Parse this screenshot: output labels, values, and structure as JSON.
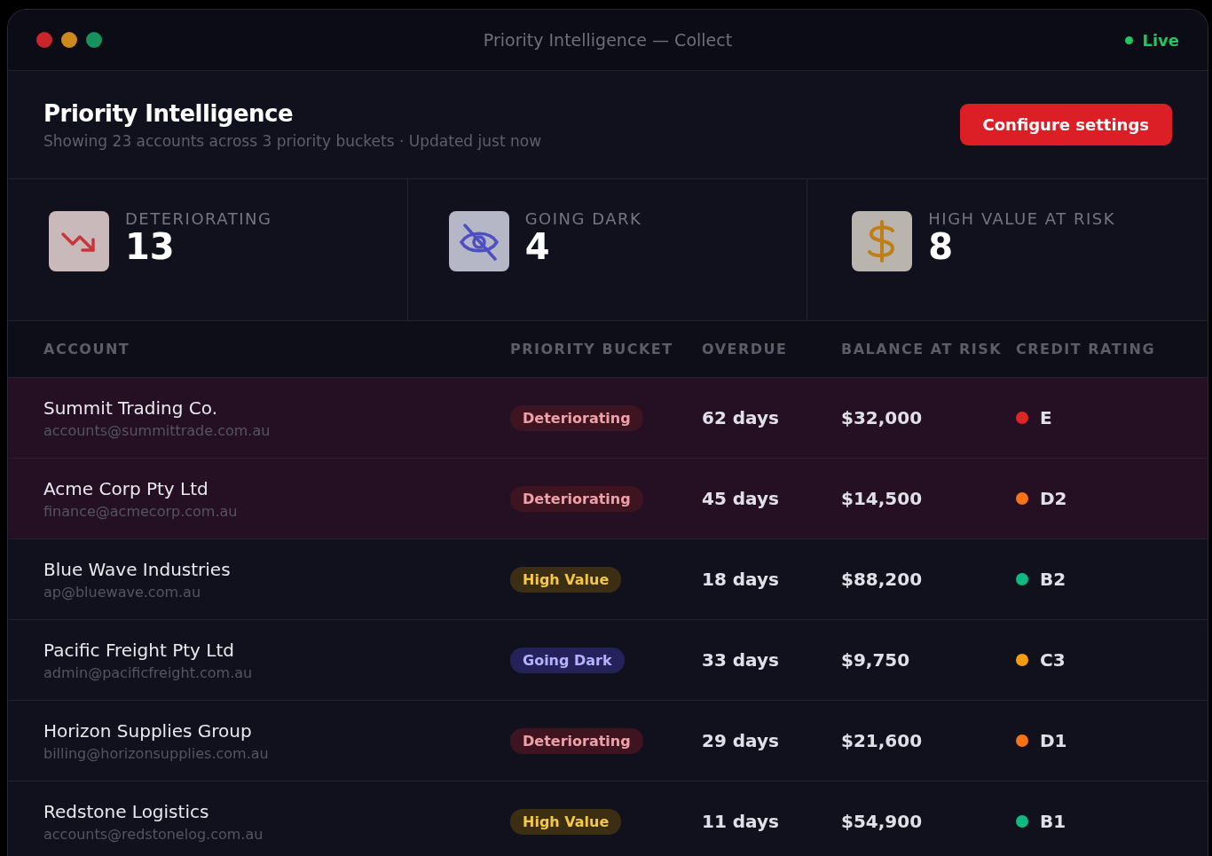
{
  "window": {
    "title": "Priority Intelligence — Collect",
    "status": {
      "label": "Live",
      "color": "#22c55e"
    }
  },
  "header": {
    "title": "Priority Intelligence",
    "subtitle": "Showing 23 accounts across 3 priority buckets · Updated just now",
    "button": "Configure settings"
  },
  "stats": [
    {
      "kind": "deteriorating",
      "label": "DETERIORATING",
      "value": "13"
    },
    {
      "kind": "going_dark",
      "label": "GOING DARK",
      "value": "4"
    },
    {
      "kind": "high_value",
      "label": "HIGH VALUE AT RISK",
      "value": "8"
    }
  ],
  "table": {
    "columns": [
      "ACCOUNT",
      "PRIORITY BUCKET",
      "OVERDUE",
      "BALANCE AT RISK",
      "CREDIT RATING"
    ],
    "rows": [
      {
        "name": "Summit Trading Co.",
        "email": "accounts@summittrade.com.au",
        "bucket": {
          "kind": "deteriorating",
          "label": "Deteriorating"
        },
        "overdue": "62 days",
        "balance": "$32,000",
        "rating": {
          "label": "E",
          "color": "#dc2626"
        },
        "highlighted": true
      },
      {
        "name": "Acme Corp Pty Ltd",
        "email": "finance@acmecorp.com.au",
        "bucket": {
          "kind": "deteriorating",
          "label": "Deteriorating"
        },
        "overdue": "45 days",
        "balance": "$14,500",
        "rating": {
          "label": "D2",
          "color": "#f97316"
        },
        "highlighted": true
      },
      {
        "name": "Blue Wave Industries",
        "email": "ap@bluewave.com.au",
        "bucket": {
          "kind": "high_value",
          "label": "High Value"
        },
        "overdue": "18 days",
        "balance": "$88,200",
        "rating": {
          "label": "B2",
          "color": "#10b981"
        },
        "highlighted": false
      },
      {
        "name": "Pacific Freight Pty Ltd",
        "email": "admin@pacificfreight.com.au",
        "bucket": {
          "kind": "going_dark",
          "label": "Going Dark"
        },
        "overdue": "33 days",
        "balance": "$9,750",
        "rating": {
          "label": "C3",
          "color": "#f59e0b"
        },
        "highlighted": false
      },
      {
        "name": "Horizon Supplies Group",
        "email": "billing@horizonsupplies.com.au",
        "bucket": {
          "kind": "deteriorating",
          "label": "Deteriorating"
        },
        "overdue": "29 days",
        "balance": "$21,600",
        "rating": {
          "label": "D1",
          "color": "#f97316"
        },
        "highlighted": false
      },
      {
        "name": "Redstone Logistics",
        "email": "accounts@redstonelog.com.au",
        "bucket": {
          "kind": "high_value",
          "label": "High Value"
        },
        "overdue": "11 days",
        "balance": "$54,900",
        "rating": {
          "label": "B1",
          "color": "#10b981"
        },
        "highlighted": false
      }
    ]
  }
}
